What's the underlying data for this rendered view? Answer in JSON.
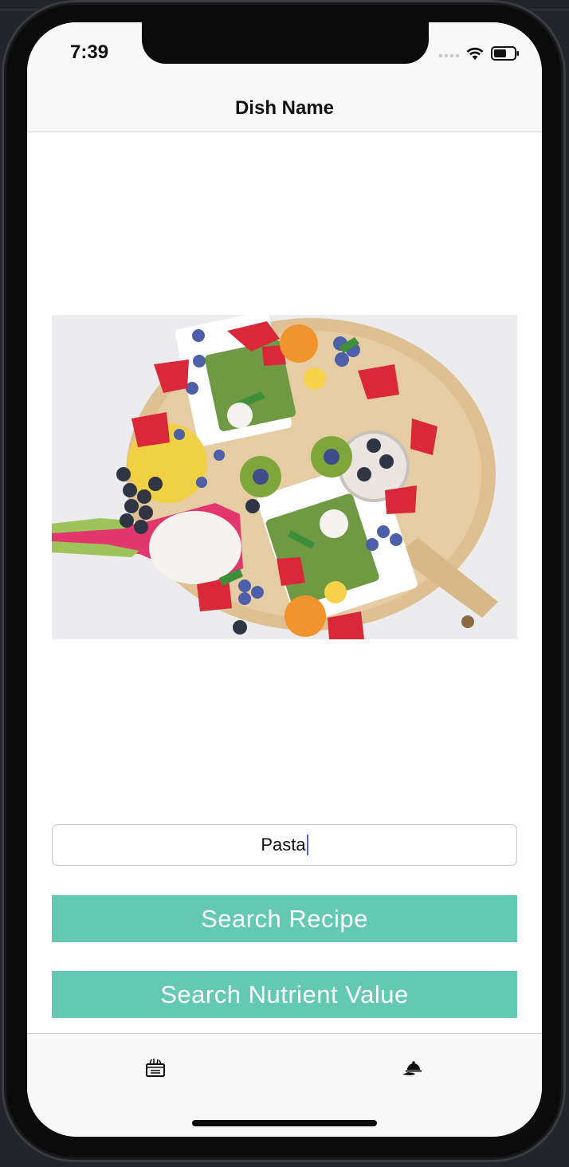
{
  "status_bar": {
    "time": "7:39",
    "icons": [
      "cellular-signal-icon",
      "wifi-icon",
      "battery-icon"
    ]
  },
  "navigation": {
    "title": "Dish Name"
  },
  "hero_image": {
    "subject": "food-platter-image"
  },
  "search_field": {
    "value": "Pasta"
  },
  "buttons": {
    "search_recipe": "Search Recipe",
    "search_nutrient": "Search Nutrient Value"
  },
  "tab_bar": {
    "items": [
      {
        "icon": "recipe-box-icon"
      },
      {
        "icon": "food-service-cloche-icon"
      }
    ]
  },
  "colors": {
    "accent": "#63c9b3",
    "caret": "#3f5ff0",
    "bar_background": "#f8f8f8"
  }
}
